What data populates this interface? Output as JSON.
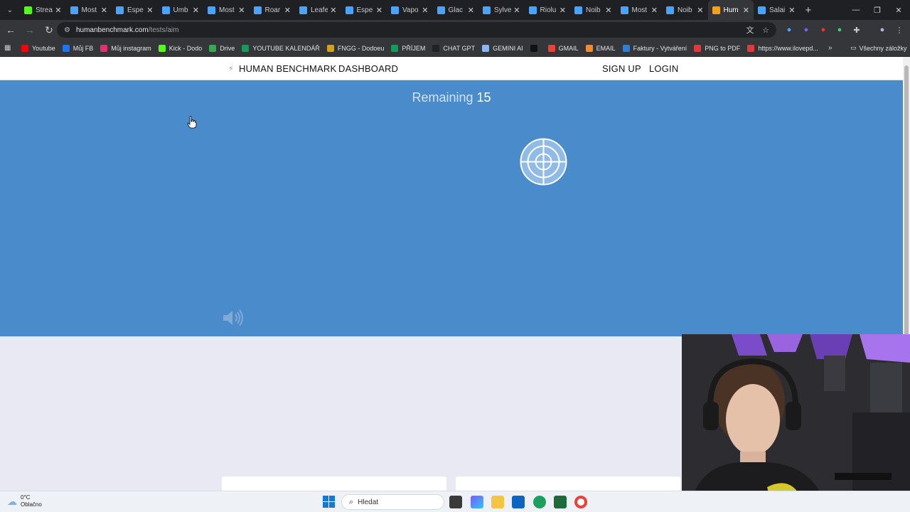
{
  "browser": {
    "tabs": [
      {
        "title": "Strea",
        "icon": "kick-icon",
        "color": "#53fc18"
      },
      {
        "title": "Most",
        "icon": "game-icon",
        "color": "#4aa3ff"
      },
      {
        "title": "Espe",
        "icon": "game-icon",
        "color": "#4aa3ff"
      },
      {
        "title": "Umb",
        "icon": "game-icon",
        "color": "#4aa3ff"
      },
      {
        "title": "Most",
        "icon": "game-icon",
        "color": "#4aa3ff"
      },
      {
        "title": "Roar",
        "icon": "game-icon",
        "color": "#4aa3ff"
      },
      {
        "title": "Leafe",
        "icon": "game-icon",
        "color": "#4aa3ff"
      },
      {
        "title": "Espe",
        "icon": "game-icon",
        "color": "#4aa3ff"
      },
      {
        "title": "Vapo",
        "icon": "game-icon",
        "color": "#4aa3ff"
      },
      {
        "title": "Glac",
        "icon": "game-icon",
        "color": "#4aa3ff"
      },
      {
        "title": "Sylve",
        "icon": "game-icon",
        "color": "#4aa3ff"
      },
      {
        "title": "Riolu",
        "icon": "game-icon",
        "color": "#4aa3ff"
      },
      {
        "title": "Noib",
        "icon": "game-icon",
        "color": "#4aa3ff"
      },
      {
        "title": "Most",
        "icon": "game-icon",
        "color": "#4aa3ff"
      },
      {
        "title": "Noib",
        "icon": "game-icon",
        "color": "#4aa3ff"
      },
      {
        "title": "Hum",
        "icon": "human-benchmark-icon",
        "color": "#f4a21a",
        "active": true
      },
      {
        "title": "Salai",
        "icon": "game-icon",
        "color": "#4aa3ff"
      }
    ],
    "url_host": "humanbenchmark.com",
    "url_path": "/tests/aim",
    "bookmarks": [
      {
        "label": "Youtube",
        "color": "#ff0000"
      },
      {
        "label": "Můj FB",
        "color": "#1877f2"
      },
      {
        "label": "Můj instagram",
        "color": "#e1306c"
      },
      {
        "label": "Kick - Dodo",
        "color": "#53fc18"
      },
      {
        "label": "Drive",
        "color": "#34a853"
      },
      {
        "label": "YOUTUBE KALENDÁŘ",
        "color": "#0f9d58"
      },
      {
        "label": "FNGG - Dodoeu",
        "color": "#d4a017"
      },
      {
        "label": "PŘÍJEM",
        "color": "#0f9d58"
      },
      {
        "label": "CHAT GPT",
        "color": "#222222"
      },
      {
        "label": "GEMINI AI",
        "color": "#8ab4f8"
      },
      {
        "label": "",
        "color": "#111111"
      },
      {
        "label": "GMAIL",
        "color": "#ea4335"
      },
      {
        "label": "EMAIL",
        "color": "#f28b30"
      },
      {
        "label": "Faktury - Vytváření",
        "color": "#2e7dd7"
      },
      {
        "label": "PNG to PDF",
        "color": "#e23a3a"
      },
      {
        "label": "https://www.ilovepd...",
        "color": "#e23a3a"
      }
    ],
    "all_bookmarks_label": "Všechny záložky"
  },
  "site": {
    "brand": "HUMAN BENCHMARK",
    "dashboard": "DASHBOARD",
    "signup": "SIGN UP",
    "login": "LOGIN"
  },
  "game": {
    "remaining_label": "Remaining",
    "remaining_value": "15"
  },
  "taskbar": {
    "temperature": "0°C",
    "weather": "Oblačno",
    "search_placeholder": "Hledat"
  },
  "colors": {
    "hero_bg": "#4a8bcb",
    "accent": "#4a8bcb"
  }
}
